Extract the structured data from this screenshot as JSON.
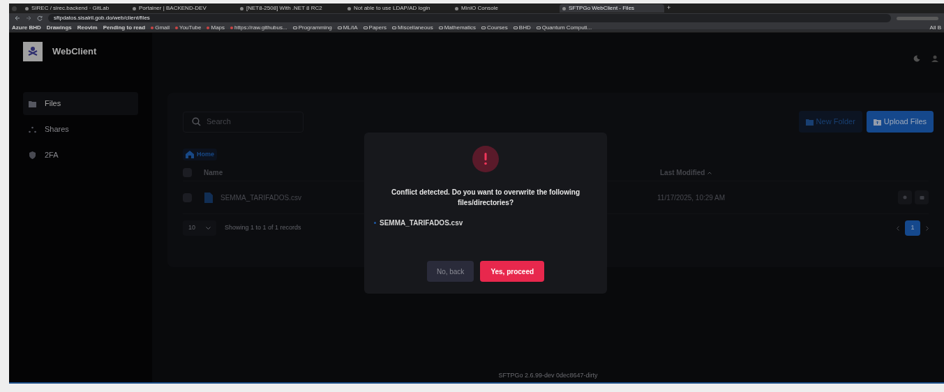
{
  "browser": {
    "tabs": [
      {
        "title": "SIREC / sirec.backend · GitLab",
        "selected": false
      },
      {
        "title": "Portainer | BACKEND-DEV",
        "selected": false
      },
      {
        "title": "[NET8-2508] With .NET 8 RC2",
        "selected": false
      },
      {
        "title": "Not able to use LDAP/AD login",
        "selected": false
      },
      {
        "title": "MinIO Console",
        "selected": false
      },
      {
        "title": "SFTPGo WebClient - Files",
        "selected": true
      }
    ],
    "new_tab": "+",
    "url": "sftpdatos.sisalril.gob.do/web/client/files",
    "bookmarks": [
      {
        "label": "Azure BHD",
        "kind": "chip"
      },
      {
        "label": "Drawings",
        "kind": "chip"
      },
      {
        "label": "Reovim",
        "kind": "chip"
      },
      {
        "label": "Pending to read",
        "kind": "chip"
      },
      {
        "label": "Gmail",
        "kind": "link"
      },
      {
        "label": "YouTube",
        "kind": "link"
      },
      {
        "label": "Maps",
        "kind": "link"
      },
      {
        "label": "https://raw.githubus...",
        "kind": "link"
      },
      {
        "label": "Programming",
        "kind": "folder"
      },
      {
        "label": "ML/IA",
        "kind": "folder"
      },
      {
        "label": "Papers",
        "kind": "folder"
      },
      {
        "label": "Miscellaneous",
        "kind": "folder"
      },
      {
        "label": "Mathematics",
        "kind": "folder"
      },
      {
        "label": "Courses",
        "kind": "folder"
      },
      {
        "label": "BHD",
        "kind": "folder"
      },
      {
        "label": "Quantum Computi...",
        "kind": "folder"
      }
    ],
    "all_bookmarks": "All B"
  },
  "app": {
    "brand": "WebClient",
    "nav": [
      {
        "label": "Files",
        "selected": true
      },
      {
        "label": "Shares",
        "selected": false
      },
      {
        "label": "2FA",
        "selected": false
      }
    ],
    "search": {
      "placeholder": "Search"
    },
    "buttons": {
      "new_folder": "New Folder",
      "upload": "Upload Files"
    },
    "breadcrumb": "Home",
    "table": {
      "all_checked": false,
      "columns": [
        "Name",
        "Last Modified"
      ],
      "rows": [
        {
          "checked": false,
          "name": "SEMMA_TARIFADOS.csv",
          "modified": "11/17/2025, 10:29 AM"
        }
      ]
    },
    "page_size": "10",
    "records": "Showing 1 to 1 of 1 records",
    "pages": [
      {
        "label": "1",
        "selected": true
      }
    ],
    "footer": "SFTPGo 2.6.99-dev 0dec8647-dirty"
  },
  "dialog": {
    "message": "Conflict detected. Do you want to overwrite the following files/directories?",
    "items": [
      "SEMMA_TARIFADOS.csv"
    ],
    "cancel": "No, back",
    "confirm": "Yes, proceed"
  }
}
